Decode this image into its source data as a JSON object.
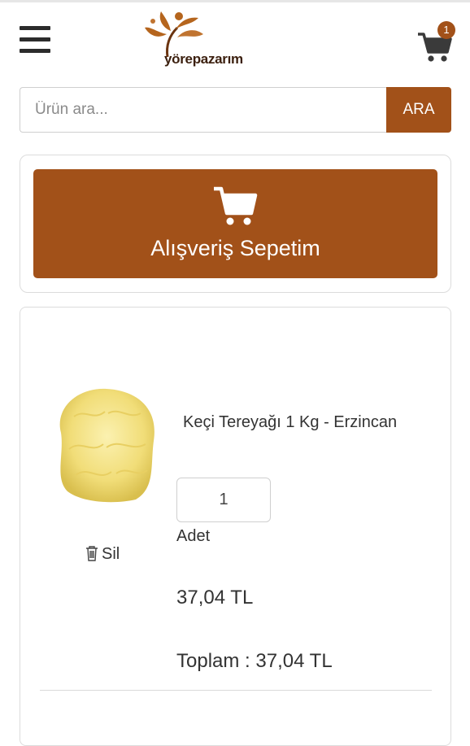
{
  "header": {
    "logo_text": "yörepazarım",
    "cart_count": "1"
  },
  "search": {
    "placeholder": "Ürün ara...",
    "button_label": "ARA"
  },
  "cart_title": "Alışveriş Sepetim",
  "items": [
    {
      "name": "Keçi Tereyağı 1 Kg - Erzincan",
      "quantity": "1",
      "quantity_label": "Adet",
      "delete_label": "Sil",
      "unit_price": "37,04 TL",
      "total": "Toplam : 37,04 TL"
    }
  ],
  "colors": {
    "brand": "#a25119",
    "logo_leaf": "#b5651d",
    "logo_text": "#3b1f0e"
  },
  "icons": [
    "menu-icon",
    "cart-icon",
    "trash-icon",
    "logo-leaf-icon"
  ]
}
